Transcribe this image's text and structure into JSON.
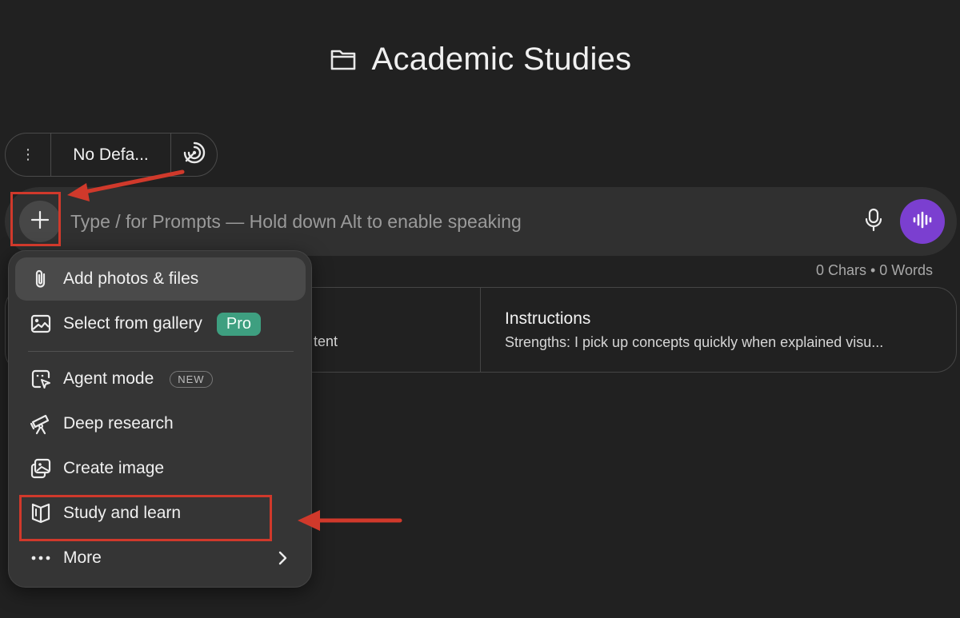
{
  "header": {
    "title": "Academic Studies",
    "icon": "folder-icon"
  },
  "pill_bar": {
    "menu_glyph": "⋮",
    "model_label": "No Defa...",
    "mode_icon": "target-spiral-icon"
  },
  "composer": {
    "placeholder": "Type / for Prompts — Hold down Alt to enable speaking",
    "value": "",
    "plus_icon": "plus-icon",
    "mic_icon": "microphone-icon",
    "voice_icon": "waveform-icon",
    "voice_color": "#7b3fd0"
  },
  "counter": {
    "text": "0 Chars • 0 Words"
  },
  "cards": {
    "left_snippet": "tent",
    "instructions_title": "Instructions",
    "instructions_desc": "Strengths: I pick up concepts quickly when explained visu..."
  },
  "menu": {
    "items": [
      {
        "label": "Add photos & files",
        "icon": "paperclip-icon",
        "active": true
      },
      {
        "label": "Select from gallery",
        "icon": "image-icon",
        "badge": "Pro"
      },
      {
        "label": "Agent mode",
        "icon": "agent-cursor-icon",
        "badge": "NEW"
      },
      {
        "label": "Deep research",
        "icon": "telescope-icon"
      },
      {
        "label": "Create image",
        "icon": "create-image-icon"
      },
      {
        "label": "Study and learn",
        "icon": "book-open-icon"
      },
      {
        "label": "More",
        "icon": "more-dots-icon",
        "chevron": "chevron-right-icon"
      }
    ]
  },
  "annotations": {
    "color": "#d0392b"
  }
}
